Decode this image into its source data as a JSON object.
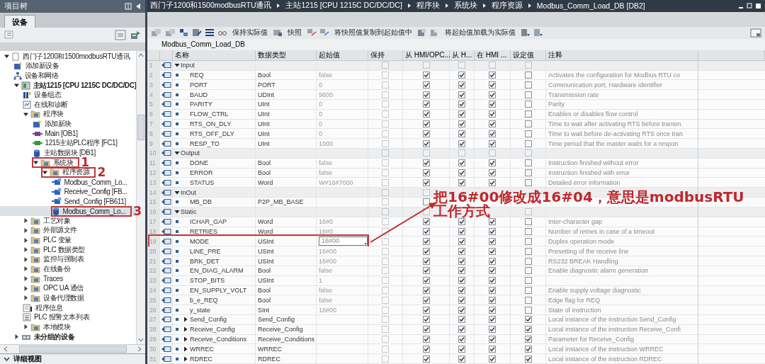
{
  "project_tree": {
    "title": "项目树",
    "tabs": [
      {
        "label": "设备",
        "selected": true
      }
    ],
    "tree": [
      {
        "label": "西门子1200和1500modbusRTU通讯",
        "kind": "project",
        "expanded": true,
        "selected": false,
        "children": [
          {
            "label": "添加新设备",
            "kind": "add",
            "selected": false
          },
          {
            "label": "设备和网络",
            "kind": "network",
            "selected": false
          },
          {
            "label": "主站1215 [CPU 1215C DC/DC/DC]",
            "kind": "device",
            "expanded": true,
            "selected": false,
            "children": [
              {
                "label": "设备组态",
                "kind": "config",
                "selected": false
              },
              {
                "label": "在线和诊断",
                "kind": "diag",
                "selected": false
              },
              {
                "label": "程序块",
                "kind": "folder",
                "expanded": true,
                "selected": false,
                "children": [
                  {
                    "label": "添加新块",
                    "kind": "add",
                    "selected": false
                  },
                  {
                    "label": "Main [OB1]",
                    "kind": "ob",
                    "selected": false
                  },
                  {
                    "label": "1215主站PLC程序 [FC1]",
                    "kind": "fc",
                    "selected": false
                  },
                  {
                    "label": "主站数据块 [DB1]",
                    "kind": "db",
                    "selected": false
                  },
                  {
                    "label": "系统块",
                    "kind": "folder",
                    "expanded": true,
                    "selected": false,
                    "callout": "1",
                    "children": [
                      {
                        "label": "程序资源",
                        "kind": "folder",
                        "expanded": true,
                        "selected": false,
                        "callout": "2",
                        "children": [
                          {
                            "label": "Modbus_Comm_Lo...",
                            "kind": "fb",
                            "selected": false
                          },
                          {
                            "label": "Receive_Config [FB...",
                            "kind": "fb",
                            "selected": false
                          },
                          {
                            "label": "Send_Config [FB611]",
                            "kind": "fb",
                            "selected": false
                          },
                          {
                            "label": "Modbus_Comm_Lo...",
                            "kind": "db",
                            "selected": true,
                            "callout": "3"
                          }
                        ]
                      }
                    ]
                  }
                ]
              },
              {
                "label": "工艺对象",
                "kind": "folder",
                "expanded": false,
                "selected": false
              },
              {
                "label": "外部源文件",
                "kind": "folder",
                "expanded": false,
                "selected": false
              },
              {
                "label": "PLC 变量",
                "kind": "folder",
                "expanded": false,
                "selected": false
              },
              {
                "label": "PLC 数据类型",
                "kind": "folder",
                "expanded": false,
                "selected": false
              },
              {
                "label": "监控与强制表",
                "kind": "folder",
                "expanded": false,
                "selected": false
              },
              {
                "label": "在线备份",
                "kind": "folder",
                "expanded": false,
                "selected": false
              },
              {
                "label": "Traces",
                "kind": "folder",
                "expanded": false,
                "selected": false
              },
              {
                "label": "OPC UA 通信",
                "kind": "folder",
                "expanded": false,
                "selected": false
              },
              {
                "label": "设备代理数据",
                "kind": "folder",
                "expanded": false,
                "selected": false
              },
              {
                "label": "程序信息",
                "kind": "info",
                "selected": false
              },
              {
                "label": "PLC 报警文本列表",
                "kind": "list",
                "selected": false
              },
              {
                "label": "本地模块",
                "kind": "folder",
                "expanded": false,
                "selected": false
              }
            ]
          },
          {
            "label": "未分组的设备",
            "kind": "group",
            "expanded": false,
            "selected": false
          }
        ]
      }
    ],
    "detail_view": "详细视图"
  },
  "breadcrumb": [
    "西门子1200和1500modbusRTU通讯",
    "主站1215 [CPU 1215C DC/DC/DC]",
    "程序块",
    "系统块",
    "程序资源",
    "Modbus_Comm_Load_DB [DB2]"
  ],
  "toolbar": [
    "保持实际值",
    "快照",
    "将快照值复制到起始值中",
    "将起始值加载为实际值"
  ],
  "block_name": "Modbus_Comm_Load_DB",
  "columns": [
    "名称",
    "数据类型",
    "起始值",
    "保持",
    "从 HMI/OPC...",
    "从 H...",
    "在 HMI ...",
    "设定值",
    "注释"
  ],
  "rows": [
    {
      "no": "1",
      "kind": "section",
      "expanded": true,
      "name": "Input",
      "retain": false,
      "hmi_access": false,
      "hmi_write": false,
      "hmi_visible": false,
      "setpoint": false,
      "selected": false,
      "annotated": false
    },
    {
      "no": "2",
      "kind": "member",
      "name": "REQ",
      "type": "Bool",
      "start": "false",
      "retain": false,
      "hmi_access": true,
      "hmi_write": true,
      "hmi_visible": true,
      "setpoint": false,
      "comment": "Activates the configuration for Modbus RTU co",
      "selected": false,
      "annotated": false
    },
    {
      "no": "3",
      "kind": "member",
      "name": "PORT",
      "type": "PORT",
      "start": "0",
      "retain": false,
      "hmi_access": true,
      "hmi_write": true,
      "hmi_visible": true,
      "setpoint": false,
      "comment": "Communication port, Hardware identifier",
      "selected": false,
      "annotated": false
    },
    {
      "no": "4",
      "kind": "member",
      "name": "BAUD",
      "type": "UDInt",
      "start": "9600",
      "retain": false,
      "hmi_access": true,
      "hmi_write": true,
      "hmi_visible": true,
      "setpoint": false,
      "comment": "Transmission rate",
      "selected": false,
      "annotated": false
    },
    {
      "no": "5",
      "kind": "member",
      "name": "PARITY",
      "type": "UInt",
      "start": "0",
      "retain": false,
      "hmi_access": true,
      "hmi_write": true,
      "hmi_visible": true,
      "setpoint": false,
      "comment": "Parity",
      "selected": false,
      "annotated": false
    },
    {
      "no": "6",
      "kind": "member",
      "name": "FLOW_CTRL",
      "type": "UInt",
      "start": "0",
      "retain": false,
      "hmi_access": true,
      "hmi_write": true,
      "hmi_visible": true,
      "setpoint": false,
      "comment": "Enables or disables flow control",
      "selected": false,
      "annotated": false
    },
    {
      "no": "7",
      "kind": "member",
      "name": "RTS_ON_DLY",
      "type": "UInt",
      "start": "0",
      "retain": false,
      "hmi_access": true,
      "hmi_write": true,
      "hmi_visible": true,
      "setpoint": false,
      "comment": "Time to wait after activating RTS before transm",
      "selected": false,
      "annotated": false
    },
    {
      "no": "8",
      "kind": "member",
      "name": "RTS_OFF_DLY",
      "type": "UInt",
      "start": "0",
      "retain": false,
      "hmi_access": true,
      "hmi_write": true,
      "hmi_visible": true,
      "setpoint": false,
      "comment": "Time to wait before de-activating RTS once tran",
      "selected": false,
      "annotated": false
    },
    {
      "no": "9",
      "kind": "member",
      "name": "RESP_TO",
      "type": "UInt",
      "start": "1000",
      "retain": false,
      "hmi_access": true,
      "hmi_write": true,
      "hmi_visible": true,
      "setpoint": false,
      "comment": "Time period that the master waits for a respon",
      "selected": false,
      "annotated": false
    },
    {
      "no": "10",
      "kind": "section",
      "expanded": true,
      "name": "Output",
      "retain": false,
      "hmi_access": false,
      "hmi_write": false,
      "hmi_visible": false,
      "setpoint": false,
      "selected": false,
      "annotated": false
    },
    {
      "no": "11",
      "kind": "member",
      "name": "DONE",
      "type": "Bool",
      "start": "false",
      "retain": false,
      "hmi_access": true,
      "hmi_write": true,
      "hmi_visible": true,
      "setpoint": false,
      "comment": "Instruction finished without error",
      "selected": false,
      "annotated": false
    },
    {
      "no": "12",
      "kind": "member",
      "name": "ERROR",
      "type": "Bool",
      "start": "false",
      "retain": false,
      "hmi_access": true,
      "hmi_write": true,
      "hmi_visible": true,
      "setpoint": false,
      "comment": "Instruction finished with error",
      "selected": false,
      "annotated": false
    },
    {
      "no": "13",
      "kind": "member",
      "name": "STATUS",
      "type": "Word",
      "start": "W#16#7000",
      "retain": false,
      "hmi_access": true,
      "hmi_write": true,
      "hmi_visible": true,
      "setpoint": false,
      "comment": "Detailed error information",
      "selected": false,
      "annotated": false
    },
    {
      "no": "14",
      "kind": "section",
      "expanded": true,
      "name": "InOut",
      "retain": false,
      "hmi_access": false,
      "selected": false,
      "annotated": false
    },
    {
      "no": "15",
      "kind": "member",
      "name": "MB_DB",
      "type": "P2P_MB_BASE",
      "retain": false,
      "hmi_access": false,
      "selected": false,
      "annotated": false
    },
    {
      "no": "16",
      "kind": "section",
      "expanded": true,
      "name": "Static",
      "retain": false,
      "hmi_access": false,
      "setpoint": false,
      "selected": false,
      "annotated": false
    },
    {
      "no": "17",
      "kind": "member",
      "name": "ICHAR_GAP",
      "type": "Word",
      "start": "16#0",
      "retain": false,
      "hmi_access": true,
      "hmi_write": true,
      "hmi_visible": true,
      "setpoint": false,
      "comment": "Inter-character gap",
      "selected": false,
      "annotated": false
    },
    {
      "no": "18",
      "kind": "member",
      "name": "RETRIES",
      "type": "Word",
      "start": "16#0",
      "retain": false,
      "hmi_access": true,
      "hmi_write": true,
      "hmi_visible": true,
      "setpoint": false,
      "comment": "Number of retries in case of a timeout",
      "selected": false,
      "annotated": false
    },
    {
      "no": "19",
      "kind": "member",
      "name": "MODE",
      "type": "USInt",
      "start": "16#00",
      "retain": false,
      "hmi_access": true,
      "hmi_write": true,
      "hmi_visible": true,
      "setpoint": false,
      "comment": "Duplex operation mode",
      "selected": true,
      "annotated": true
    },
    {
      "no": "20",
      "kind": "member",
      "name": "LINE_PRE",
      "type": "USInt",
      "start": "16#00",
      "retain": false,
      "hmi_access": true,
      "hmi_write": true,
      "hmi_visible": true,
      "setpoint": false,
      "comment": "Presetting of the receive line",
      "selected": false,
      "annotated": false
    },
    {
      "no": "21",
      "kind": "member",
      "name": "BRK_DET",
      "type": "USInt",
      "start": "16#00",
      "retain": false,
      "hmi_access": true,
      "hmi_write": true,
      "hmi_visible": true,
      "setpoint": false,
      "comment": "RS232 BREAK Handling",
      "selected": false,
      "annotated": false
    },
    {
      "no": "22",
      "kind": "member",
      "name": "EN_DIAG_ALARM",
      "type": "Bool",
      "start": "false",
      "retain": false,
      "hmi_access": true,
      "hmi_write": true,
      "hmi_visible": true,
      "setpoint": false,
      "comment": "Enable diagnostic alarm generation",
      "selected": false,
      "annotated": false
    },
    {
      "no": "23",
      "kind": "member",
      "name": "STOP_BITS",
      "type": "USInt",
      "start": "1",
      "retain": false,
      "hmi_access": true,
      "hmi_write": true,
      "hmi_visible": true,
      "setpoint": false,
      "selected": false,
      "annotated": false
    },
    {
      "no": "24",
      "kind": "member",
      "name": "EN_SUPPLY_VOLT",
      "type": "Bool",
      "start": "false",
      "retain": false,
      "hmi_access": true,
      "hmi_write": true,
      "hmi_visible": true,
      "setpoint": false,
      "comment": "Enable supply voltage diagnostic",
      "selected": false,
      "annotated": false
    },
    {
      "no": "25",
      "kind": "member",
      "name": "b_e_REQ",
      "type": "Bool",
      "start": "false",
      "retain": false,
      "hmi_access": true,
      "hmi_write": true,
      "hmi_visible": true,
      "setpoint": false,
      "comment": "Edge flag for REQ",
      "selected": false,
      "annotated": false
    },
    {
      "no": "26",
      "kind": "member",
      "name": "y_state",
      "type": "SInt",
      "start": "16#00",
      "retain": false,
      "hmi_access": true,
      "hmi_write": true,
      "hmi_visible": true,
      "setpoint": false,
      "comment": "State of instruction",
      "selected": false,
      "annotated": false
    },
    {
      "no": "27",
      "kind": "struct",
      "expanded": false,
      "name": "Send_Config",
      "type": "Send_Config",
      "retain": false,
      "hmi_access": true,
      "hmi_write": true,
      "hmi_visible": true,
      "setpoint": true,
      "comment": "Local instance of the instruction Send_Config",
      "selected": false,
      "annotated": false
    },
    {
      "no": "28",
      "kind": "struct",
      "expanded": false,
      "name": "Receive_Config",
      "type": "Receive_Config",
      "retain": false,
      "hmi_access": true,
      "hmi_write": true,
      "hmi_visible": true,
      "setpoint": true,
      "comment": "Local instance of the instruction Receive_Confi",
      "selected": false,
      "annotated": false
    },
    {
      "no": "29",
      "kind": "struct",
      "expanded": false,
      "name": "Receive_Conditions",
      "type": "Receive_Conditions",
      "retain": false,
      "hmi_access": true,
      "hmi_write": true,
      "hmi_visible": true,
      "setpoint": true,
      "comment": "Parameter for Receive_Config",
      "selected": false,
      "annotated": false
    },
    {
      "no": "30",
      "kind": "struct",
      "expanded": false,
      "name": "WRREC",
      "type": "WRREC",
      "retain": false,
      "hmi_access": true,
      "hmi_write": true,
      "hmi_visible": true,
      "setpoint": true,
      "comment": "Local instance of the instruction WRREC",
      "selected": false,
      "annotated": false
    },
    {
      "no": "31",
      "kind": "struct",
      "expanded": false,
      "name": "RDREC",
      "type": "RDREC",
      "retain": false,
      "hmi_access": true,
      "hmi_write": true,
      "hmi_visible": true,
      "setpoint": true,
      "comment": "Local instance of the instruction RDREC",
      "selected": false,
      "annotated": false
    }
  ],
  "callout": {
    "lines": [
      "把16#00修改成16#04，意思是modbusRTU",
      "工作方式"
    ]
  }
}
